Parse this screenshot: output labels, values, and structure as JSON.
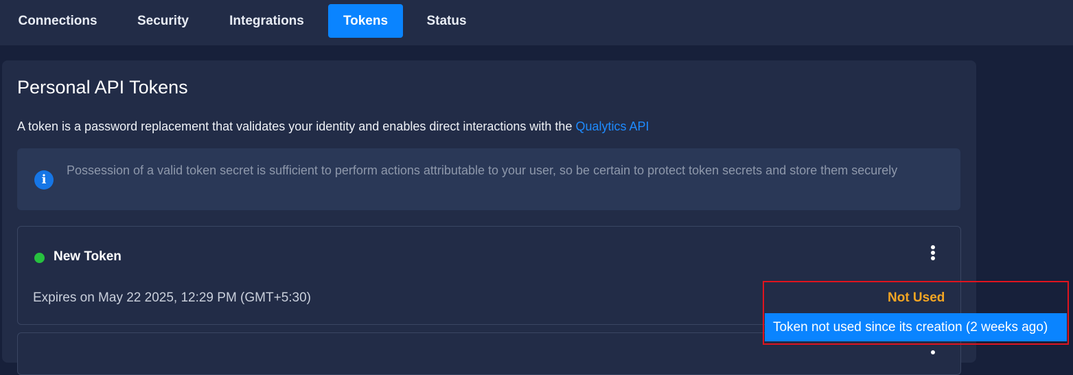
{
  "tabs": [
    {
      "label": "Connections",
      "active": false
    },
    {
      "label": "Security",
      "active": false
    },
    {
      "label": "Integrations",
      "active": false
    },
    {
      "label": "Tokens",
      "active": true
    },
    {
      "label": "Status",
      "active": false
    }
  ],
  "section": {
    "title": "Personal API Tokens",
    "description": "A token is a password replacement that validates your identity and enables direct interactions with the ",
    "link_text": "Qualytics API"
  },
  "info": {
    "icon": "info-icon",
    "text": "Possession of a valid token secret is sufficient to perform actions attributable to your user, so be certain to protect token secrets and store them securely"
  },
  "tokens": [
    {
      "name": "New Token",
      "status_color": "#27c13f",
      "expires": "Expires on May 22 2025, 12:29 PM (GMT+5:30)",
      "usage": "Not Used",
      "usage_tooltip": "Token not used since its creation (2 weeks ago)",
      "menu_icon": "more-vertical-icon"
    }
  ],
  "colors": {
    "accent": "#0a84ff",
    "warning": "#f5a623",
    "success": "#27c13f",
    "highlight": "#e0141e"
  }
}
